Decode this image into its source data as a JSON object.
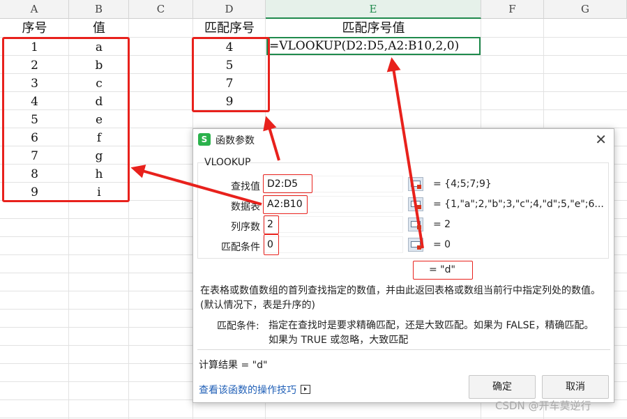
{
  "columns": [
    "A",
    "B",
    "C",
    "D",
    "E",
    "F",
    "G"
  ],
  "headers": {
    "a1": "序号",
    "b1": "值",
    "d1": "匹配序号",
    "e1": "匹配序号值"
  },
  "seq_numbers": [
    "1",
    "2",
    "3",
    "4",
    "5",
    "6",
    "7",
    "8",
    "9"
  ],
  "values": [
    "a",
    "b",
    "c",
    "d",
    "e",
    "f",
    "g",
    "h",
    "i"
  ],
  "match_numbers": [
    "4",
    "5",
    "7",
    "9"
  ],
  "formula": "=VLOOKUP(D2:D5,A2:B10,2,0)",
  "dialog": {
    "title": "函数参数",
    "function_name": "VLOOKUP",
    "params": [
      {
        "label": "查找值",
        "value": "D2:D5",
        "result": "= {4;5;7;9}"
      },
      {
        "label": "数据表",
        "value": "A2:B10",
        "result": "= {1,\"a\";2,\"b\";3,\"c\";4,\"d\";5,\"e\";6..."
      },
      {
        "label": "列序数",
        "value": "2",
        "result": "= 2"
      },
      {
        "label": "匹配条件",
        "value": "0",
        "result": "= 0"
      }
    ],
    "formula_result": "= \"d\"",
    "description": "在表格或数值数组的首列查找指定的数值，并由此返回表格或数组当前行中指定列处的数值。(默认情况下，表是升序的)",
    "param_desc_label": "匹配条件:",
    "param_desc": "指定在查找时是要求精确匹配，还是大致匹配。如果为 FALSE，精确匹配。如果为 TRUE 或忽略，大致匹配",
    "calc_result": "计算结果 = \"d\"",
    "help_link": "查看该函数的操作技巧",
    "ok": "确定",
    "cancel": "取消"
  },
  "watermark": "CSDN @开车莫逆行",
  "colors": {
    "annotation": "#e8211c",
    "selection": "#1f8a4c"
  }
}
